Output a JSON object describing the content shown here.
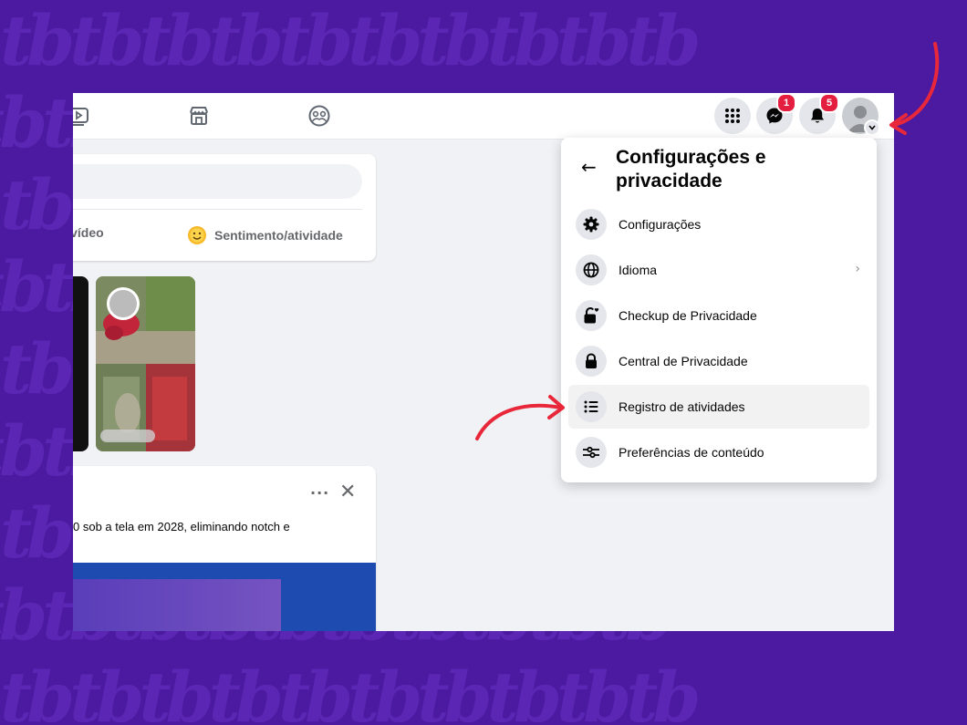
{
  "colors": {
    "page_background": "#4b1aa0",
    "pattern": "#5a26b3",
    "annotation_arrow": "#e8283a",
    "badge": "#e41e3f",
    "screen_background": "#f0f2f5"
  },
  "background_pattern": {
    "rows": [
      "tbtbtbtbtbtbtbtbtbtb",
      "tbtbtbtbtbtbtbtbtbtb",
      "tbtbtbtbtbtbtbtbtbtb",
      "tbtbtbtbtbtbtbtbtbtb",
      "tbtbtbtbtbtbtbtbtbtb",
      "tbtbtbtbtbtbtbtbtbtb",
      "tbtbtbtbtbtbtbtbtbtb",
      "tbtbtbtbtbtbtbtbtbtb",
      "tbtbtbtbtbtbtbtbtbtb"
    ]
  },
  "topbar": {
    "nav_icons": [
      "video-icon",
      "marketplace-icon",
      "groups-icon"
    ],
    "menu_button": {
      "icon": "menu-grid-icon"
    },
    "messenger": {
      "icon": "messenger-icon",
      "badge": "1"
    },
    "notifications": {
      "icon": "bell-icon",
      "badge": "5"
    },
    "account": {
      "icon": "avatar",
      "chevron": "chevron-down-icon"
    }
  },
  "composer": {
    "photo_action": "to/vídeo",
    "feeling_action": "Sentimento/atividade",
    "feeling_icon": "smile-icon"
  },
  "post": {
    "text": "0 sob a tela em 2028, eliminando notch e",
    "more_label": "···",
    "close_label": "✕"
  },
  "menu": {
    "back_label": "←",
    "title": "Configurações e privacidade",
    "items": [
      {
        "label": "Configurações",
        "icon": "gear-icon"
      },
      {
        "label": "Idioma",
        "icon": "globe-icon",
        "has_submenu": true,
        "chevron": "›"
      },
      {
        "label": "Checkup de Privacidade",
        "icon": "lock-heart-icon"
      },
      {
        "label": "Central de Privacidade",
        "icon": "lock-icon"
      },
      {
        "label": "Registro de atividades",
        "icon": "list-icon",
        "highlighted": true
      },
      {
        "label": "Preferências de conteúdo",
        "icon": "sliders-icon"
      }
    ]
  }
}
